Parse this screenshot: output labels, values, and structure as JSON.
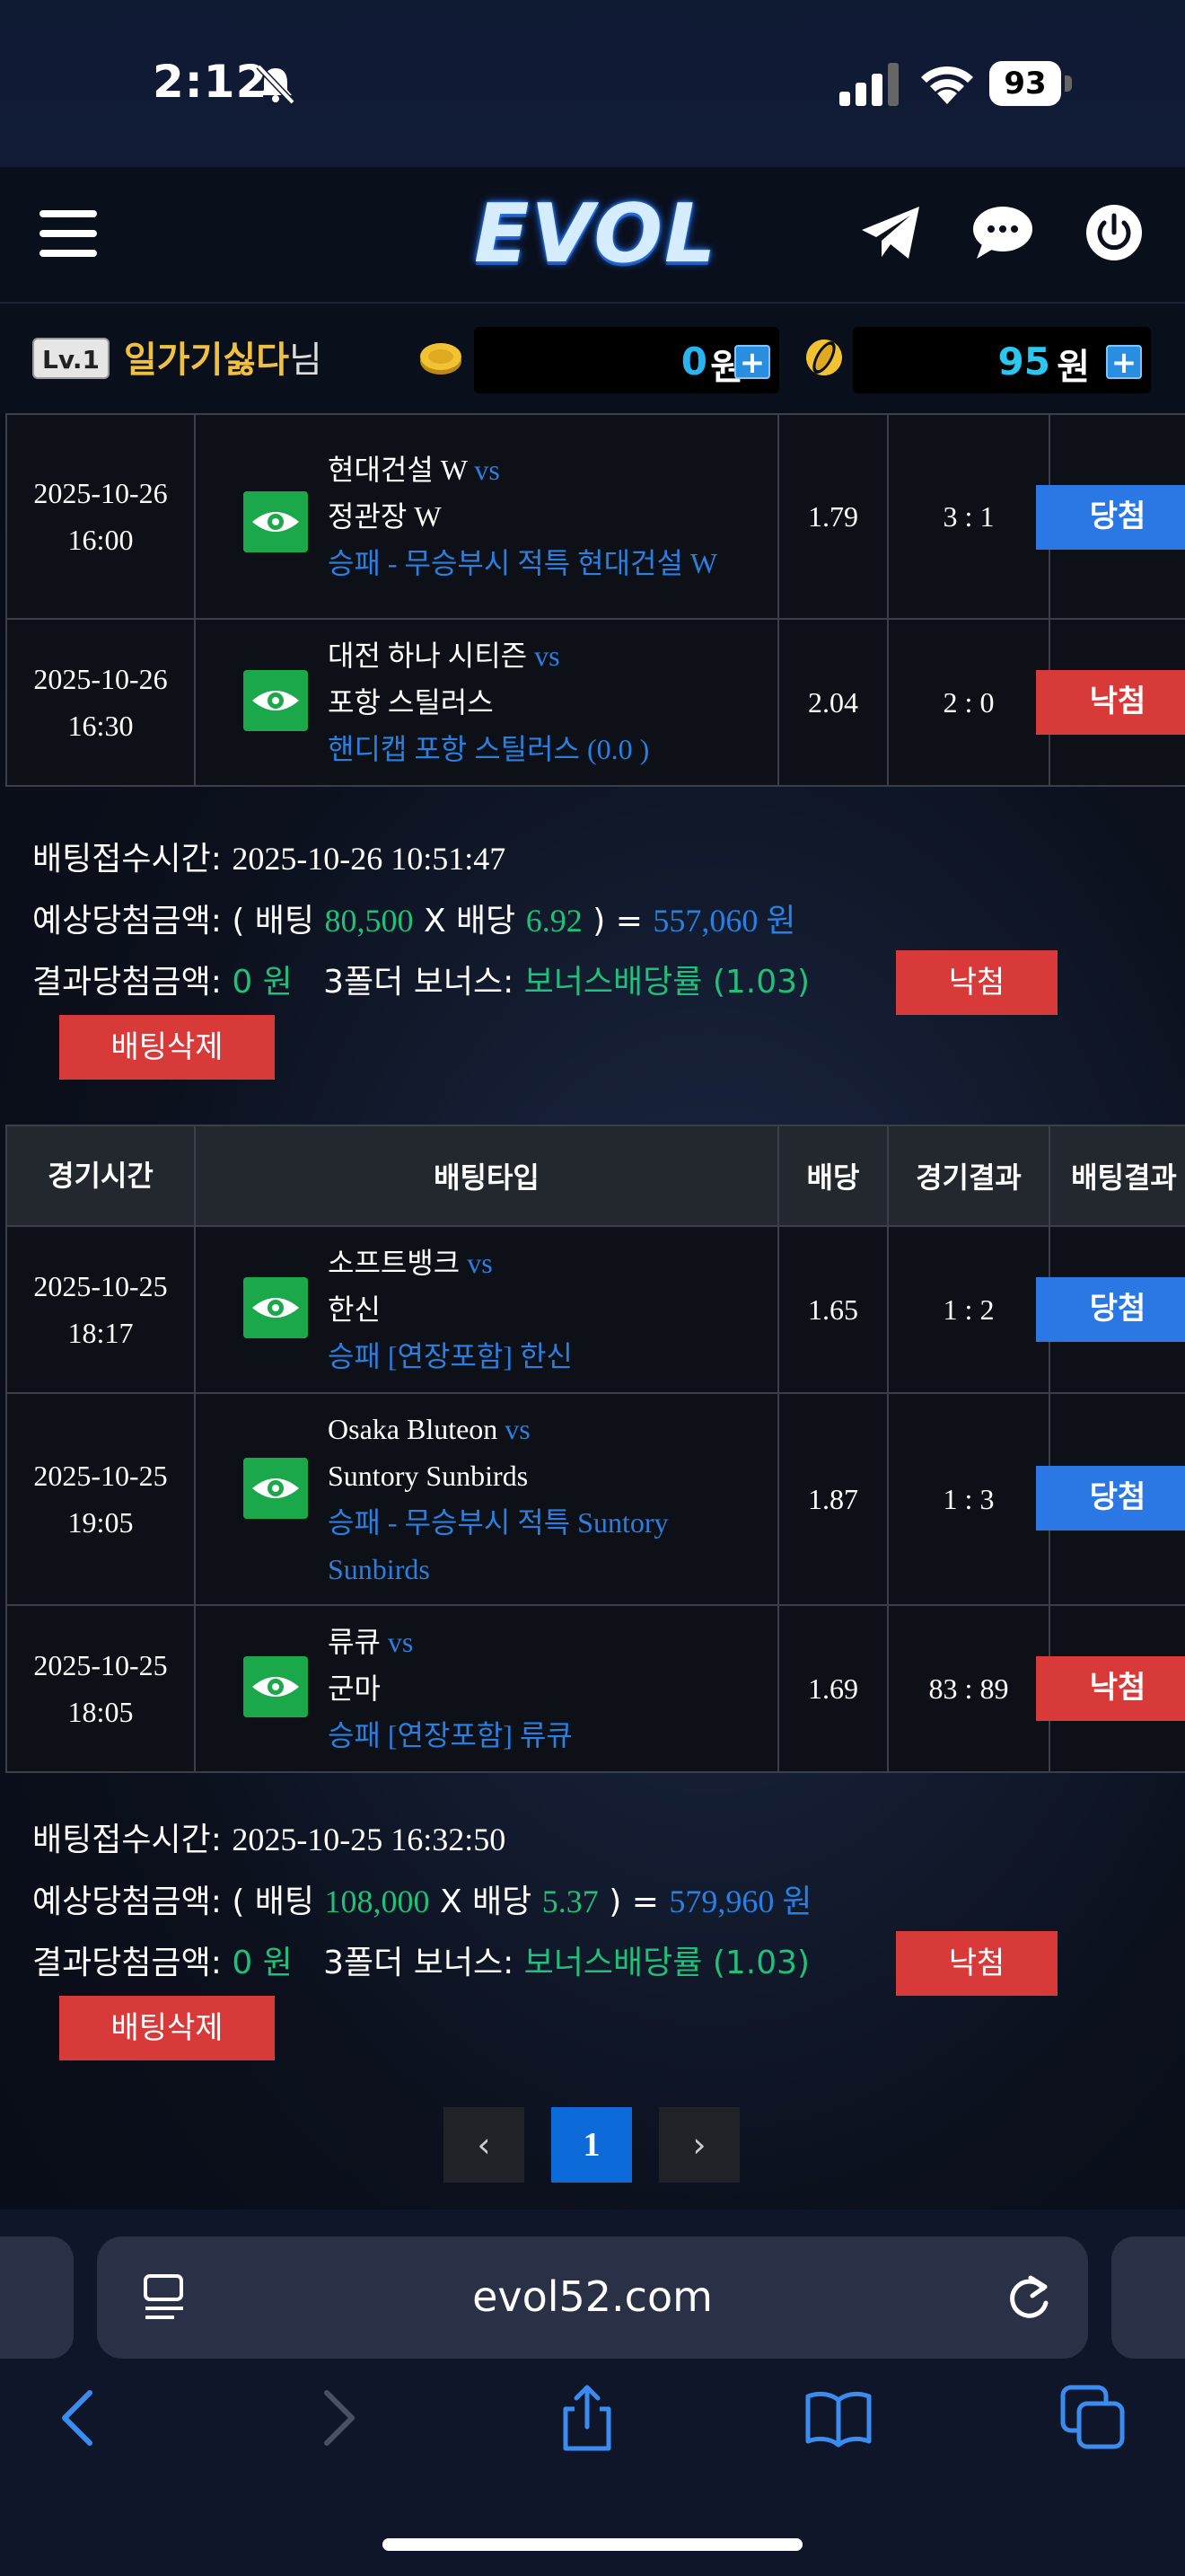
{
  "status": {
    "time": "2:12",
    "battery": "93"
  },
  "header": {
    "logo": "EVOL"
  },
  "user": {
    "level": "Lv.1",
    "name": "일가기싫다",
    "suffix": "님",
    "money": "0",
    "money_unit": "원",
    "points": "95",
    "points_unit": "원",
    "plus": "+"
  },
  "bet1": {
    "rows": [
      {
        "date": "2025-10-26",
        "time": "16:00",
        "home": "현대건설 W",
        "vs": "vs",
        "away": "정관장 W",
        "type": "승패 - 무승부시 적특 현대건설 W",
        "odds": "1.79",
        "score": "3 : 1",
        "result": "당첨"
      },
      {
        "date": "2025-10-26",
        "time": "16:30",
        "home": "대전 하나 시티즌",
        "vs": "vs",
        "away": "포항 스틸러스",
        "type": "핸디캡 포항 스틸러스 (0.0 )",
        "odds": "2.04",
        "score": "2 : 0",
        "result": "낙첨"
      }
    ],
    "time_label": "배팅접수시간:",
    "time_value": "2025-10-26 10:51:47",
    "expected_label": "예상당첨금액:",
    "open_paren": "( 배팅",
    "stake": "80,500",
    "x_label": "X 배당",
    "total_odds": "6.92",
    "close_eq": ") =",
    "expected": "557,060 원",
    "result_label": "결과당첨금액:",
    "result_amount": "0 원",
    "bonus_label": "3폴더 보너스:",
    "bonus_value": "보너스배당률 (1.03)",
    "status": "낙첨",
    "delete": "배팅삭제"
  },
  "table_headers": {
    "time": "경기시간",
    "type": "배팅타입",
    "odds": "배당",
    "score": "경기결과",
    "result": "배팅결과"
  },
  "bet2": {
    "rows": [
      {
        "date": "2025-10-25",
        "time": "18:17",
        "home": "소프트뱅크",
        "vs": "vs",
        "away": "한신",
        "type": "승패 [연장포함] 한신",
        "odds": "1.65",
        "score": "1 : 2",
        "result": "당첨"
      },
      {
        "date": "2025-10-25",
        "time": "19:05",
        "home": "Osaka Bluteon",
        "vs": "vs",
        "away": "Suntory Sunbirds",
        "type": "승패 - 무승부시 적특 Suntory Sunbirds",
        "odds": "1.87",
        "score": "1 : 3",
        "result": "당첨"
      },
      {
        "date": "2025-10-25",
        "time": "18:05",
        "home": "류큐",
        "vs": "vs",
        "away": "군마",
        "type": "승패 [연장포함] 류큐",
        "odds": "1.69",
        "score": "83 : 89",
        "result": "낙첨"
      }
    ],
    "time_label": "배팅접수시간:",
    "time_value": "2025-10-25 16:32:50",
    "expected_label": "예상당첨금액:",
    "open_paren": "( 배팅",
    "stake": "108,000",
    "x_label": "X 배당",
    "total_odds": "5.37",
    "close_eq": ") =",
    "expected": "579,960 원",
    "result_label": "결과당첨금액:",
    "result_amount": "0 원",
    "bonus_label": "3폴더 보너스:",
    "bonus_value": "보너스배당률 (1.03)",
    "status": "낙첨",
    "delete": "배팅삭제"
  },
  "pagination": {
    "prev": "‹",
    "current": "1",
    "next": "›"
  },
  "browser": {
    "url": "evol52.com"
  },
  "colors": {
    "win": "#2b78e4",
    "lose": "#d83a3a",
    "accent_green": "#1fc07a",
    "accent_blue": "#2a7fe0",
    "eye_green": "#1aa84a"
  }
}
